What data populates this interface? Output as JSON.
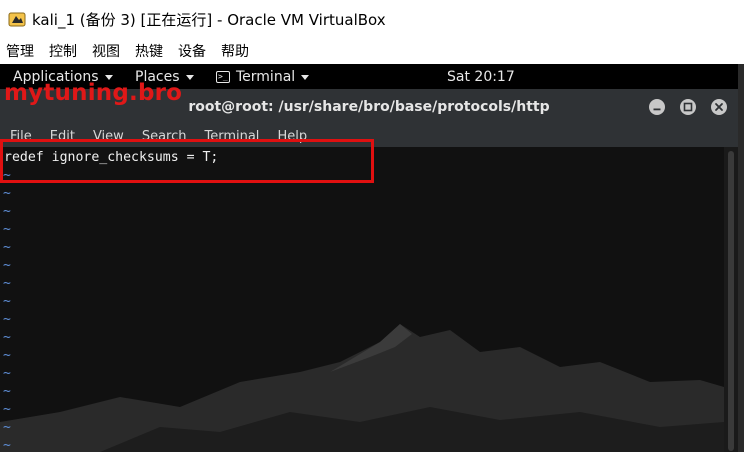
{
  "vbox": {
    "title": "kali_1 (备份 3) [正在运行] - Oracle VM VirtualBox",
    "menu": [
      "管理",
      "控制",
      "视图",
      "热键",
      "设备",
      "帮助"
    ]
  },
  "gnome_topbar": {
    "applications": "Applications",
    "places": "Places",
    "terminal": "Terminal",
    "clock": "Sat 20:17"
  },
  "terminal": {
    "title": "root@root: /usr/share/bro/base/protocols/http",
    "menu": [
      "File",
      "Edit",
      "View",
      "Search",
      "Terminal",
      "Help"
    ],
    "lines": [
      "redef ignore_checksums = T;"
    ],
    "empty_line_marker": "~"
  },
  "watermark": "mytuning.bro",
  "colors": {
    "highlight": "#e01010",
    "vim_tilde": "#5f8fd8"
  }
}
